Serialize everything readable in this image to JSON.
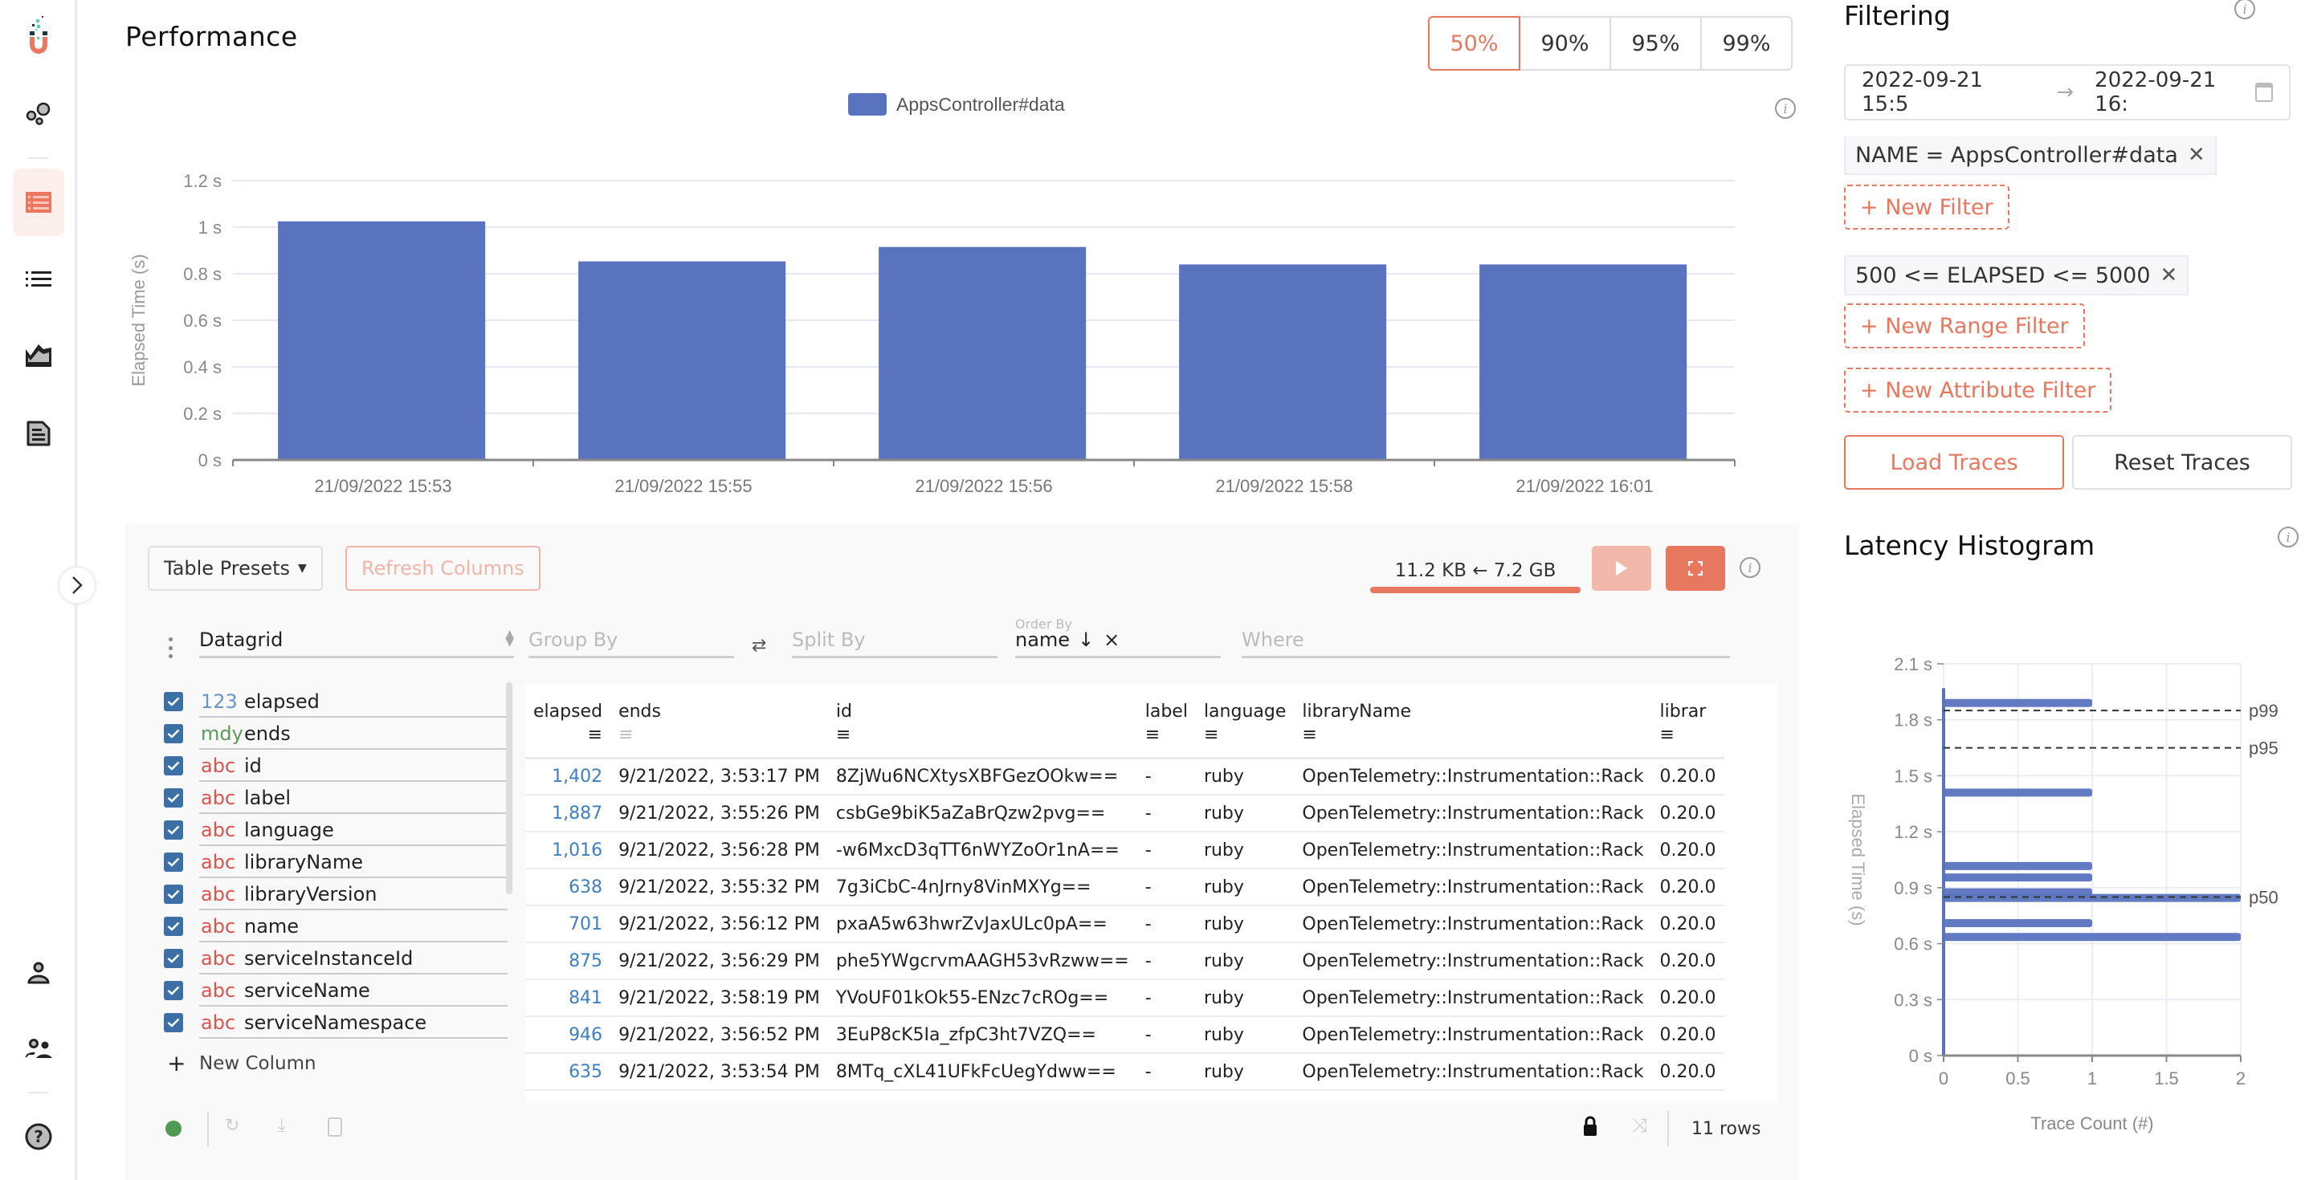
{
  "sidebar": {
    "items": [
      {
        "icon": "logo-magnet-icon"
      },
      {
        "icon": "bubbles-icon"
      },
      {
        "icon": "table-list-icon",
        "active": true
      },
      {
        "icon": "list-icon"
      },
      {
        "icon": "area-chart-icon"
      },
      {
        "icon": "document-icon"
      },
      {
        "icon": "user-icon"
      },
      {
        "icon": "users-icon"
      },
      {
        "icon": "help-icon"
      }
    ]
  },
  "header": {
    "title": "Performance",
    "percentiles": [
      "50%",
      "90%",
      "95%",
      "99%"
    ],
    "active_percentile": "50%"
  },
  "chart_data": [
    {
      "type": "bar",
      "title": "",
      "legend": [
        "AppsController#data"
      ],
      "legend_position": "top-center",
      "categories": [
        "21/09/2022 15:53",
        "21/09/2022 15:55",
        "21/09/2022 15:56",
        "21/09/2022 15:58",
        "21/09/2022 16:01"
      ],
      "series": [
        {
          "name": "AppsController#data",
          "color": "#5a73bf",
          "values": [
            1.025,
            0.853,
            0.915,
            0.84,
            0.84
          ]
        }
      ],
      "xlabel": "",
      "ylabel": "Elapsed Time (s)",
      "ylim": [
        0,
        1.2
      ],
      "yticks": [
        "0 s",
        "0.2 s",
        "0.4 s",
        "0.6 s",
        "0.8 s",
        "1 s",
        "1.2 s"
      ],
      "grid": true
    },
    {
      "type": "bar",
      "orientation": "horizontal",
      "title": "Latency Histogram",
      "xlabel": "Trace Count (#)",
      "ylabel": "Elapsed Time (s)",
      "xlim": [
        0,
        2
      ],
      "ylim": [
        0,
        2.1
      ],
      "xticks": [
        "0",
        "0.5",
        "1",
        "1.5",
        "2"
      ],
      "yticks": [
        "0 s",
        "0.3 s",
        "0.6 s",
        "0.9 s",
        "1.2 s",
        "1.5 s",
        "1.8 s",
        "2.1 s"
      ],
      "bins": [
        {
          "elapsed": 1.89,
          "count": 1
        },
        {
          "elapsed": 1.41,
          "count": 1
        },
        {
          "elapsed": 1.016,
          "count": 1
        },
        {
          "elapsed": 0.955,
          "count": 1
        },
        {
          "elapsed": 0.875,
          "count": 1
        },
        {
          "elapsed": 0.845,
          "count": 2
        },
        {
          "elapsed": 0.71,
          "count": 1
        },
        {
          "elapsed": 0.636,
          "count": 2
        }
      ],
      "percentile_lines": [
        {
          "label": "p99",
          "value": 1.85
        },
        {
          "label": "p95",
          "value": 1.65
        },
        {
          "label": "p50",
          "value": 0.85
        }
      ],
      "grid": true
    }
  ],
  "chart_info_icon": "info-icon",
  "table": {
    "presets_label": "Table Presets",
    "refresh_label": "Refresh Columns",
    "transfer_text": "11.2 KB ← 7.2 GB",
    "transfer_progress": 1.0,
    "plugin": "Datagrid",
    "group_by_placeholder": "Group By",
    "split_by_placeholder": "Split By",
    "order_by_label": "Order By",
    "order_by_value": "name",
    "where_placeholder": "Where",
    "new_column_label": "New Column",
    "row_count": "11 rows",
    "columns": [
      {
        "type": "123",
        "type_color": "#6b96c8",
        "name": "elapsed"
      },
      {
        "type": "mdy",
        "type_color": "#5a9a5a",
        "name": "ends"
      },
      {
        "type": "abc",
        "type_color": "#d9534f",
        "name": "id"
      },
      {
        "type": "abc",
        "type_color": "#d9534f",
        "name": "label"
      },
      {
        "type": "abc",
        "type_color": "#d9534f",
        "name": "language"
      },
      {
        "type": "abc",
        "type_color": "#d9534f",
        "name": "libraryName"
      },
      {
        "type": "abc",
        "type_color": "#d9534f",
        "name": "libraryVersion"
      },
      {
        "type": "abc",
        "type_color": "#d9534f",
        "name": "name"
      },
      {
        "type": "abc",
        "type_color": "#d9534f",
        "name": "serviceInstanceId"
      },
      {
        "type": "abc",
        "type_color": "#d9534f",
        "name": "serviceName"
      },
      {
        "type": "abc",
        "type_color": "#d9534f",
        "name": "serviceNamespace"
      }
    ],
    "headers": [
      "elapsed",
      "ends",
      "id",
      "label",
      "language",
      "libraryName",
      "librar"
    ],
    "rows": [
      [
        "1,402",
        "9/21/2022, 3:53:17 PM",
        "8ZjWu6NCXtysXBFGezOOkw==",
        "-",
        "ruby",
        "OpenTelemetry::Instrumentation::Rack",
        "0.20.0"
      ],
      [
        "1,887",
        "9/21/2022, 3:55:26 PM",
        "csbGe9biK5aZaBrQzw2pvg==",
        "-",
        "ruby",
        "OpenTelemetry::Instrumentation::Rack",
        "0.20.0"
      ],
      [
        "1,016",
        "9/21/2022, 3:56:28 PM",
        "-w6MxcD3qTT6nWYZoOr1nA==",
        "-",
        "ruby",
        "OpenTelemetry::Instrumentation::Rack",
        "0.20.0"
      ],
      [
        "638",
        "9/21/2022, 3:55:32 PM",
        "7g3iCbC-4nJrny8VinMXYg==",
        "-",
        "ruby",
        "OpenTelemetry::Instrumentation::Rack",
        "0.20.0"
      ],
      [
        "701",
        "9/21/2022, 3:56:12 PM",
        "pxaA5w63hwrZvJaxULc0pA==",
        "-",
        "ruby",
        "OpenTelemetry::Instrumentation::Rack",
        "0.20.0"
      ],
      [
        "875",
        "9/21/2022, 3:56:29 PM",
        "phe5YWgcrvmAAGH53vRzww==",
        "-",
        "ruby",
        "OpenTelemetry::Instrumentation::Rack",
        "0.20.0"
      ],
      [
        "841",
        "9/21/2022, 3:58:19 PM",
        "YVoUF01kOk55-ENzc7cROg==",
        "-",
        "ruby",
        "OpenTelemetry::Instrumentation::Rack",
        "0.20.0"
      ],
      [
        "946",
        "9/21/2022, 3:56:52 PM",
        "3EuP8cK5Ia_zfpC3ht7VZQ==",
        "-",
        "ruby",
        "OpenTelemetry::Instrumentation::Rack",
        "0.20.0"
      ],
      [
        "635",
        "9/21/2022, 3:53:54 PM",
        "8MTq_cXL41UFkFcUegYdww==",
        "-",
        "ruby",
        "OpenTelemetry::Instrumentation::Rack",
        "0.20.0"
      ]
    ]
  },
  "filtering": {
    "title": "Filtering",
    "date_from": "2022-09-21 15:5",
    "date_to": "2022-09-21 16:",
    "name_filter": "NAME = AppsController#data",
    "new_filter_label": "+ New Filter",
    "range_filter": "500 <= ELAPSED <= 5000",
    "new_range_filter_label": "+ New Range Filter",
    "new_attribute_filter_label": "+ New Attribute Filter",
    "load_label": "Load Traces",
    "reset_label": "Reset Traces"
  },
  "histogram": {
    "title": "Latency Histogram"
  },
  "colors": {
    "accent": "#e8775f",
    "bar": "#5a73bf",
    "checkbox": "#3b6fa5",
    "status_ok": "#4e9a55"
  }
}
